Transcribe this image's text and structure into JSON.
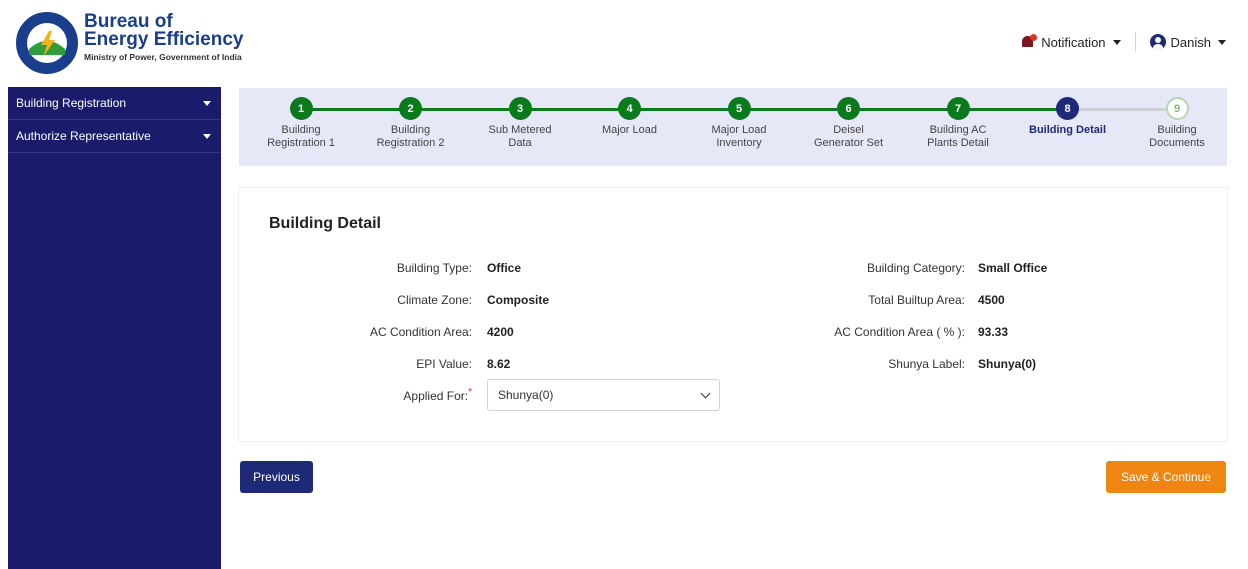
{
  "brand": {
    "line1": "Bureau of",
    "line2": "Energy Efficiency",
    "subtitle": "Ministry of Power, Government of India"
  },
  "header": {
    "notification_label": "Notification",
    "user_name": "Danish"
  },
  "sidebar": {
    "items": [
      {
        "label": "Building Registration"
      },
      {
        "label": "Authorize Representative"
      }
    ]
  },
  "stepper": {
    "steps": [
      {
        "number": "1",
        "line1": "Building",
        "line2": "Registration 1",
        "status": "done"
      },
      {
        "number": "2",
        "line1": "Building",
        "line2": "Registration 2",
        "status": "done"
      },
      {
        "number": "3",
        "line1": "Sub Metered",
        "line2": "Data",
        "status": "done"
      },
      {
        "number": "4",
        "line1": "Major Load",
        "line2": "",
        "status": "done"
      },
      {
        "number": "5",
        "line1": "Major Load",
        "line2": "Inventory",
        "status": "done"
      },
      {
        "number": "6",
        "line1": "Deisel",
        "line2": "Generator Set",
        "status": "done"
      },
      {
        "number": "7",
        "line1": "Building AC",
        "line2": "Plants Detail",
        "status": "done"
      },
      {
        "number": "8",
        "line1": "Building Detail",
        "line2": "",
        "status": "active"
      },
      {
        "number": "9",
        "line1": "Building",
        "line2": "Documents",
        "status": "todo"
      }
    ],
    "colors": {
      "done": "#0b7a1c",
      "active": "#1e2a78",
      "todo": "#b5d6ae"
    }
  },
  "detail": {
    "title": "Building Detail",
    "building_type_label": "Building Type:",
    "building_type": "Office",
    "climate_zone_label": "Climate Zone:",
    "climate_zone": "Composite",
    "ac_area_label": "AC Condition Area:",
    "ac_area": "4200",
    "epi_label": "EPI Value:",
    "epi": "8.62",
    "applied_for_label": "Applied For:",
    "applied_for_required": "*",
    "applied_for_value": "Shunya(0)",
    "building_category_label": "Building Category:",
    "building_category": "Small Office",
    "builtup_area_label": "Total Builtup Area:",
    "builtup_area": "4500",
    "ac_percent_label": "AC Condition Area ( % ):",
    "ac_percent": "93.33",
    "shunya_label_label": "Shunya Label:",
    "shunya_label": "Shunya(0)"
  },
  "actions": {
    "previous": "Previous",
    "save_continue": "Save & Continue"
  }
}
